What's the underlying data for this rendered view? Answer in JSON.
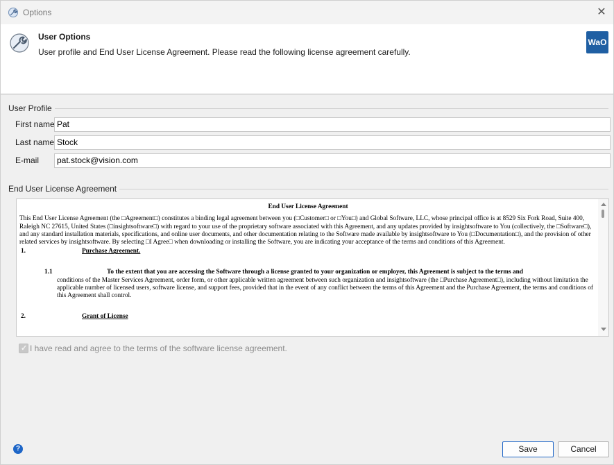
{
  "window": {
    "title": "Options",
    "close_symbol": "✕"
  },
  "header": {
    "title": "User Options",
    "description": "User profile and End User License Agreement. Please read the following license agreement carefully.",
    "logo_text": "WaO",
    "icon": "wrench-icon"
  },
  "profile": {
    "group_label": "User Profile",
    "fields": [
      {
        "label": "First name",
        "value": "Pat"
      },
      {
        "label": "Last name",
        "value": "Stock"
      },
      {
        "label": "E-mail",
        "value": "pat.stock@vision.com"
      }
    ]
  },
  "eula": {
    "group_label": "End User License Agreement",
    "title": "End User License Agreement",
    "intro": "This End User License Agreement (the □Agreement□) constitutes a binding legal agreement between you (□Customer□ or □You□) and Global Software, LLC, whose principal office is at 8529 Six Fork Road, Suite 400, Raleigh NC 27615, United States (□insightsoftware□) with regard to your use of the proprietary software associated with this Agreement, and any updates provided by insightsoftware to You (collectively, the □Software□), and any  standard installation materials, specifications, and online user documents, and other documentation relating to the Software made available by insightsoftware to You  (□Documentation□), and the provision of other related services by insightsoftware. By selecting □I Agree□ when downloading or installing the Software, you are indicating your acceptance of the terms and conditions of this Agreement.",
    "sections": [
      {
        "num": "1.",
        "heading": "Purchase Agreement."
      },
      {
        "num": "2.",
        "heading": "Grant of License"
      }
    ],
    "subsection": {
      "num": "1.1",
      "text_bold": "To the extent that you are accessing the Software through a license granted to your organization or employer, this Agreement is subject to the terms and",
      "text_rest": "conditions of the Master Services Agreement, order form, or other applicable written agreement between such organization and insightsoftware (the □Purchase Agreement□), including without limitation the applicable number of licensed users, software license, and support fees, provided that in the event of any conflict between the terms of this Agreement and the Purchase Agreement, the terms and conditions of this Agreement shall control."
    }
  },
  "agree": {
    "label": "I have read and agree to the terms of the software license agreement.",
    "checked": true,
    "enabled": false
  },
  "buttons": {
    "save": "Save",
    "cancel": "Cancel",
    "help": "?"
  },
  "colors": {
    "accent": "#1e66c7",
    "logo_bg": "#1f5fa3"
  }
}
